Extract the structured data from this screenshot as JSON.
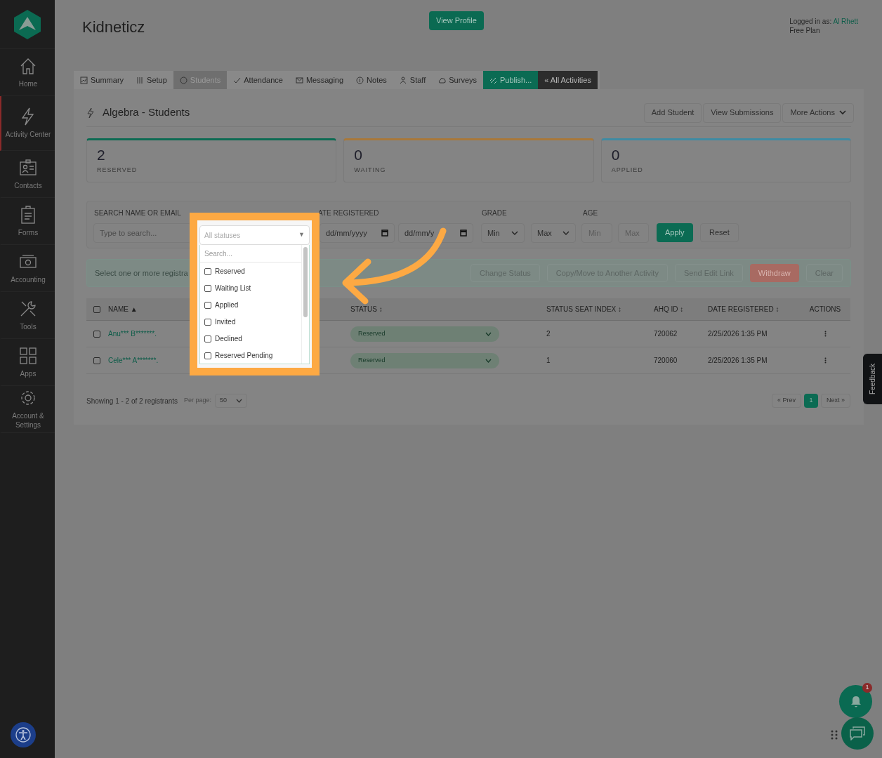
{
  "sidebar": {
    "items": [
      {
        "label": "Home",
        "selected": false
      },
      {
        "label": "Activity Center",
        "selected": true
      },
      {
        "label": "Contacts",
        "selected": false
      },
      {
        "label": "Forms",
        "selected": false
      },
      {
        "label": "Accounting",
        "selected": false
      },
      {
        "label": "Tools",
        "selected": false
      },
      {
        "label": "Apps",
        "selected": false
      },
      {
        "label": "Account & Settings",
        "selected": false
      }
    ]
  },
  "header": {
    "title": "Kidneticz",
    "view_profile": "View Profile",
    "logged_in_label": "Logged in as:",
    "user": "Al Rhett",
    "plan": "Free Plan"
  },
  "tabs": [
    {
      "label": "Summary",
      "selected": false,
      "kind": "normal"
    },
    {
      "label": "Setup",
      "selected": false,
      "kind": "normal"
    },
    {
      "label": "Students",
      "selected": true,
      "kind": "normal"
    },
    {
      "label": "Attendance",
      "selected": false,
      "kind": "normal"
    },
    {
      "label": "Messaging",
      "selected": false,
      "kind": "normal"
    },
    {
      "label": "Notes",
      "selected": false,
      "kind": "normal"
    },
    {
      "label": "Staff",
      "selected": false,
      "kind": "normal"
    },
    {
      "label": "Surveys",
      "selected": false,
      "kind": "normal"
    },
    {
      "label": "Publish...",
      "selected": false,
      "kind": "publish"
    },
    {
      "label": "« All Activities",
      "selected": false,
      "kind": "back"
    }
  ],
  "page_title": "Algebra - Students",
  "header_buttons": [
    "Add Student",
    "View Submissions",
    "More Actions"
  ],
  "stats": [
    {
      "value": "2",
      "label": "RESERVED",
      "color": "#0d6b53"
    },
    {
      "value": "0",
      "label": "WAITING",
      "color": "#a8783a"
    },
    {
      "value": "0",
      "label": "APPLIED",
      "color": "#3f8ba3"
    }
  ],
  "filters": {
    "search_label": "SEARCH NAME OR EMAIL",
    "search_placeholder": "Type to search...",
    "date_label": "ATE REGISTERED",
    "date_from": "dd/mm/yyyy",
    "date_to": "dd/mm/y",
    "grade_label": "GRADE",
    "grade_min": "Min",
    "grade_max": "Max",
    "age_label": "AGE",
    "age_min_placeholder": "Min",
    "age_max_placeholder": "Max",
    "apply": "Apply",
    "reset": "Reset"
  },
  "bulk_bar": {
    "message": "Select one or more registra",
    "actions": [
      {
        "label": "Change Status",
        "kind": "normal"
      },
      {
        "label": "Copy/Move to Another Activity",
        "kind": "normal"
      },
      {
        "label": "Send Edit Link",
        "kind": "normal"
      },
      {
        "label": "Withdraw",
        "kind": "danger"
      },
      {
        "label": "Clear",
        "kind": "normal"
      }
    ]
  },
  "table": {
    "columns": [
      {
        "label": "NAME ▲"
      },
      {
        "label": "STATUS ↕"
      },
      {
        "label": "STATUS SEAT INDEX ↕"
      },
      {
        "label": "AHQ ID ↕"
      },
      {
        "label": "DATE REGISTERED ↕"
      },
      {
        "label": "ACTIONS"
      }
    ],
    "select_all_checked": false,
    "rows": [
      {
        "checked": false,
        "name": "Anu*** B*******.",
        "status": "Reserved",
        "seat_index": "2",
        "ahq_id": "720062",
        "date": "2/25/2026 1:35 PM"
      },
      {
        "checked": false,
        "name": "Cele*** A*******.",
        "status": "Reserved",
        "seat_index": "1",
        "ahq_id": "720060",
        "date": "2/25/2026 1:35 PM"
      }
    ]
  },
  "footer": {
    "showing": "Showing 1 - 2 of 2 registrants",
    "per_page_label": "Per page:",
    "per_page": "50",
    "prev": "« Prev",
    "pages": [
      {
        "label": "1",
        "selected": true
      }
    ],
    "next": "Next »"
  },
  "status_dropdown": {
    "placeholder": "All statuses",
    "caret": "▼",
    "search_placeholder": "Search...",
    "options": [
      {
        "label": "Reserved",
        "checked": false
      },
      {
        "label": "Waiting List",
        "checked": false
      },
      {
        "label": "Applied",
        "checked": false
      },
      {
        "label": "Invited",
        "checked": false
      },
      {
        "label": "Declined",
        "checked": false
      },
      {
        "label": "Reserved Pending",
        "checked": false
      }
    ]
  },
  "feedback": "Feedback",
  "notification_count": "1"
}
